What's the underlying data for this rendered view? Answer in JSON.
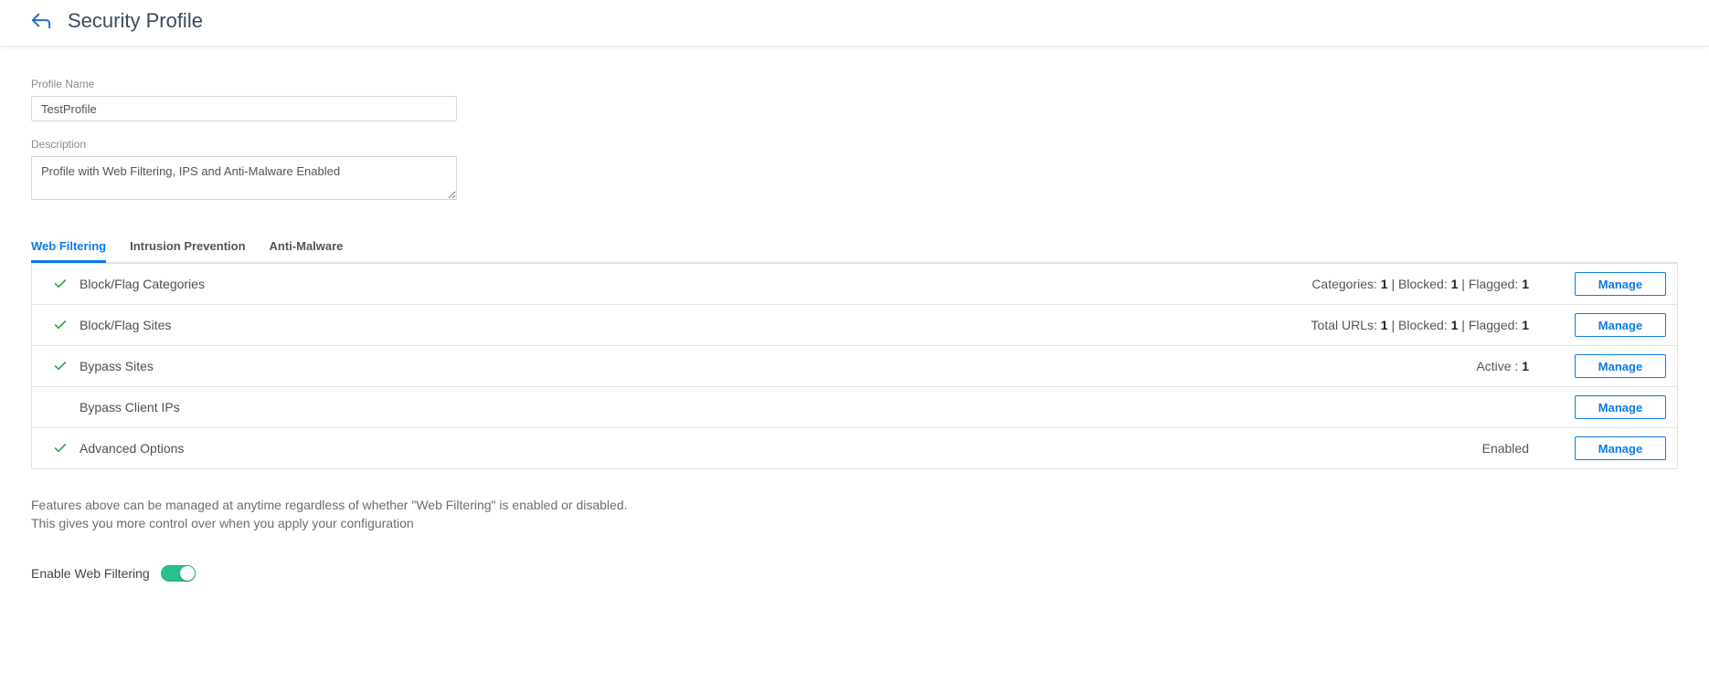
{
  "header": {
    "title": "Security Profile"
  },
  "form": {
    "profile_name_label": "Profile Name",
    "profile_name_value": "TestProfile",
    "description_label": "Description",
    "description_value": "Profile with Web Filtering, IPS and Anti-Malware Enabled"
  },
  "tabs": {
    "web_filtering": "Web Filtering",
    "intrusion_prevention": "Intrusion Prevention",
    "anti_malware": "Anti-Malware"
  },
  "rows": {
    "block_categories": {
      "label": "Block/Flag Categories",
      "sum": {
        "a_label": "Categories: ",
        "a_val": "1",
        "b_label": " | Blocked: ",
        "b_val": "1",
        "c_label": " | Flagged: ",
        "c_val": "1"
      }
    },
    "block_sites": {
      "label": "Block/Flag Sites",
      "sum": {
        "a_label": "Total URLs: ",
        "a_val": "1",
        "b_label": " | Blocked: ",
        "b_val": "1",
        "c_label": " | Flagged: ",
        "c_val": "1"
      }
    },
    "bypass_sites": {
      "label": "Bypass Sites",
      "sum": {
        "a_label": "Active : ",
        "a_val": "1"
      }
    },
    "bypass_ips": {
      "label": "Bypass Client IPs"
    },
    "advanced": {
      "label": "Advanced Options",
      "sum": {
        "a_label": "Enabled"
      }
    }
  },
  "buttons": {
    "manage": "Manage"
  },
  "helper": {
    "line1": "Features above can be managed at anytime regardless of whether \"Web Filtering\" is enabled or disabled.",
    "line2": "This gives you more control over when you apply your configuration"
  },
  "enable": {
    "label": "Enable Web Filtering",
    "on": true
  }
}
